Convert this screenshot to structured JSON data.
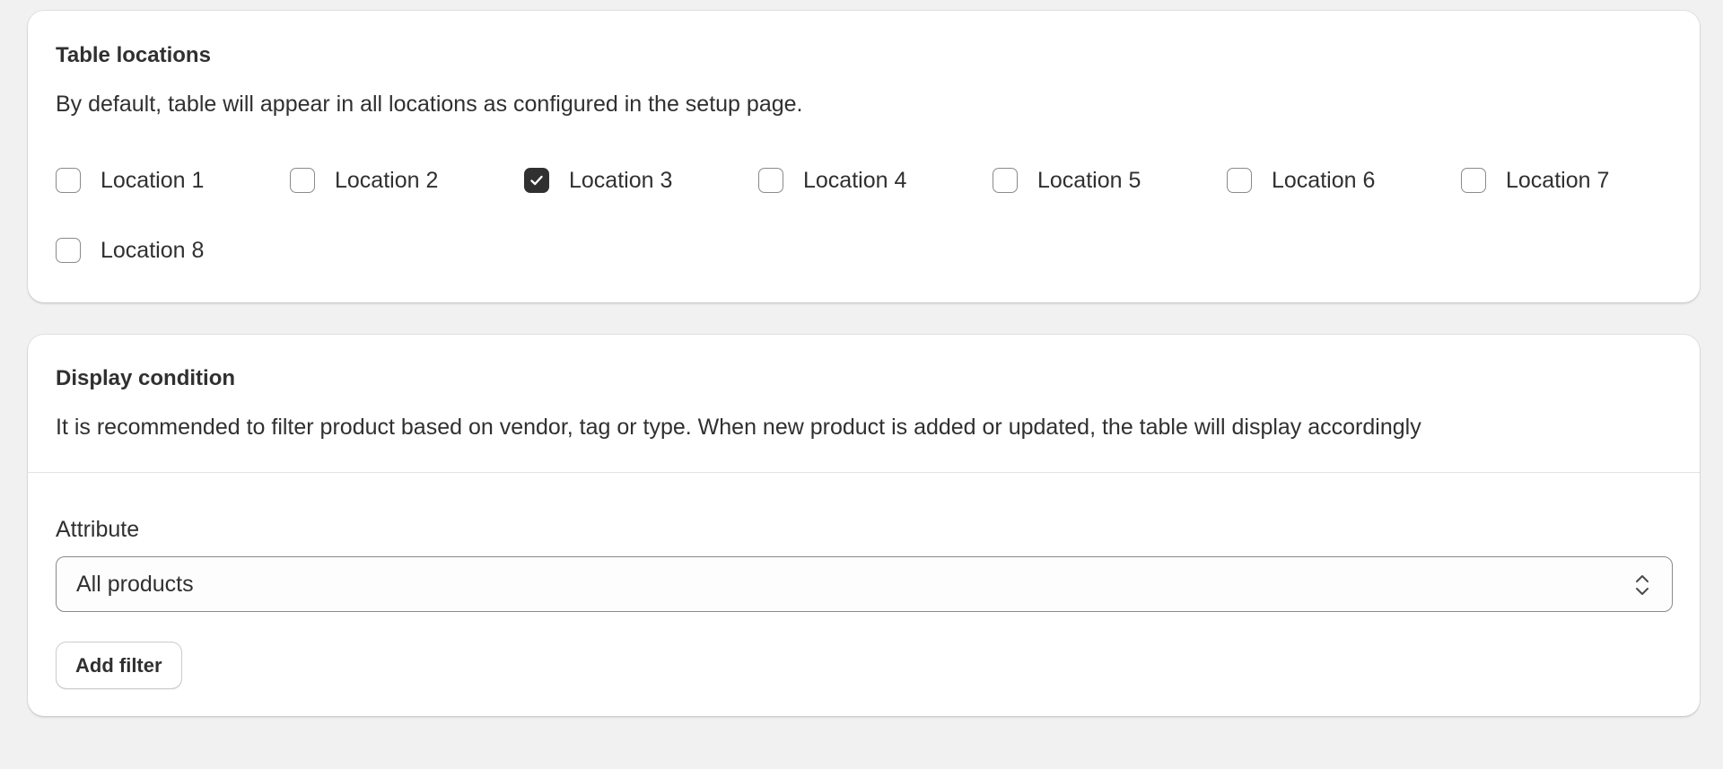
{
  "locations_card": {
    "title": "Table locations",
    "description": "By default, table will appear in all locations as configured in the setup page.",
    "items": [
      {
        "label": "Location 1",
        "checked": false
      },
      {
        "label": "Location 2",
        "checked": false
      },
      {
        "label": "Location 3",
        "checked": true
      },
      {
        "label": "Location 4",
        "checked": false
      },
      {
        "label": "Location 5",
        "checked": false
      },
      {
        "label": "Location 6",
        "checked": false
      },
      {
        "label": "Location 7",
        "checked": false
      },
      {
        "label": "Location 8",
        "checked": false
      }
    ]
  },
  "display_card": {
    "title": "Display condition",
    "description": "It is recommended to filter product based on vendor, tag or type. When new product is added or updated, the table will display accordingly",
    "attribute_label": "Attribute",
    "attribute_value": "All products",
    "add_filter_label": "Add filter"
  },
  "colors": {
    "page_background": "#f1f1f1",
    "card_background": "#ffffff",
    "text": "#303030",
    "checkbox_checked": "#303030",
    "border": "#8a8a8a"
  },
  "icons": {
    "checkmark": "checkmark-icon",
    "select_chevron": "select-chevron-icon"
  }
}
